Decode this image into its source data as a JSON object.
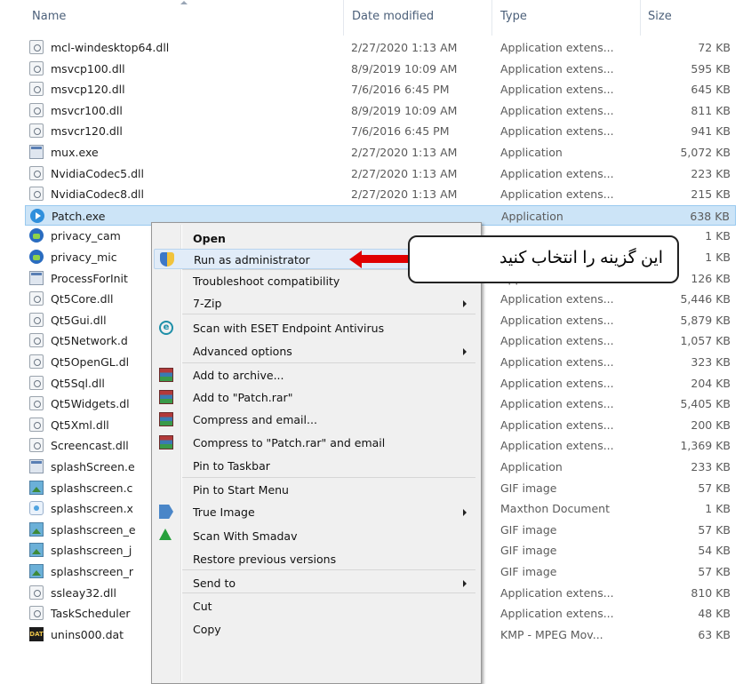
{
  "columns": {
    "name": "Name",
    "date": "Date modified",
    "type": "Type",
    "size": "Size"
  },
  "files": [
    {
      "name": "mcl-windesktop64.dll",
      "date": "2/27/2020 1:13 AM",
      "type": "Application extens...",
      "size": "72 KB",
      "icon": "dll"
    },
    {
      "name": "msvcp100.dll",
      "date": "8/9/2019 10:09 AM",
      "type": "Application extens...",
      "size": "595 KB",
      "icon": "dll"
    },
    {
      "name": "msvcp120.dll",
      "date": "7/6/2016 6:45 PM",
      "type": "Application extens...",
      "size": "645 KB",
      "icon": "dll"
    },
    {
      "name": "msvcr100.dll",
      "date": "8/9/2019 10:09 AM",
      "type": "Application extens...",
      "size": "811 KB",
      "icon": "dll"
    },
    {
      "name": "msvcr120.dll",
      "date": "7/6/2016 6:45 PM",
      "type": "Application extens...",
      "size": "941 KB",
      "icon": "dll"
    },
    {
      "name": "mux.exe",
      "date": "2/27/2020 1:13 AM",
      "type": "Application",
      "size": "5,072 KB",
      "icon": "exe"
    },
    {
      "name": "NvidiaCodec5.dll",
      "date": "2/27/2020 1:13 AM",
      "type": "Application extens...",
      "size": "223 KB",
      "icon": "dll"
    },
    {
      "name": "NvidiaCodec8.dll",
      "date": "2/27/2020 1:13 AM",
      "type": "Application extens...",
      "size": "215 KB",
      "icon": "dll"
    },
    {
      "name": "Patch.exe",
      "date": "",
      "type": "Application",
      "size": "638 KB",
      "icon": "patch",
      "selected": true
    },
    {
      "name": "privacy_cam",
      "date": "",
      "type": "",
      "size": "1 KB",
      "icon": "app2"
    },
    {
      "name": "privacy_mic",
      "date": "",
      "type": "",
      "size": "1 KB",
      "icon": "app2"
    },
    {
      "name": "ProcessForInit",
      "date": "",
      "type": "Application",
      "size": "126 KB",
      "icon": "exe"
    },
    {
      "name": "Qt5Core.dll",
      "date": "",
      "type": "Application extens...",
      "size": "5,446 KB",
      "icon": "dll"
    },
    {
      "name": "Qt5Gui.dll",
      "date": "",
      "type": "Application extens...",
      "size": "5,879 KB",
      "icon": "dll"
    },
    {
      "name": "Qt5Network.d",
      "date": "",
      "type": "Application extens...",
      "size": "1,057 KB",
      "icon": "dll"
    },
    {
      "name": "Qt5OpenGL.dl",
      "date": "",
      "type": "Application extens...",
      "size": "323 KB",
      "icon": "dll"
    },
    {
      "name": "Qt5Sql.dll",
      "date": "",
      "type": "Application extens...",
      "size": "204 KB",
      "icon": "dll"
    },
    {
      "name": "Qt5Widgets.dl",
      "date": "",
      "type": "Application extens...",
      "size": "5,405 KB",
      "icon": "dll"
    },
    {
      "name": "Qt5Xml.dll",
      "date": "",
      "type": "Application extens...",
      "size": "200 KB",
      "icon": "dll"
    },
    {
      "name": "Screencast.dll",
      "date": "",
      "type": "Application extens...",
      "size": "1,369 KB",
      "icon": "dll"
    },
    {
      "name": "splashScreen.e",
      "date": "",
      "type": "Application",
      "size": "233 KB",
      "icon": "exe"
    },
    {
      "name": "splashscreen.c",
      "date": "",
      "type": "GIF image",
      "size": "57 KB",
      "icon": "gif"
    },
    {
      "name": "splashscreen.x",
      "date": "",
      "type": "Maxthon Document",
      "size": "1 KB",
      "icon": "xml"
    },
    {
      "name": "splashscreen_e",
      "date": "",
      "type": "GIF image",
      "size": "57 KB",
      "icon": "gif"
    },
    {
      "name": "splashscreen_j",
      "date": "",
      "type": "GIF image",
      "size": "54 KB",
      "icon": "gif"
    },
    {
      "name": "splashscreen_r",
      "date": "",
      "type": "GIF image",
      "size": "57 KB",
      "icon": "gif"
    },
    {
      "name": "ssleay32.dll",
      "date": "",
      "type": "Application extens...",
      "size": "810 KB",
      "icon": "dll"
    },
    {
      "name": "TaskScheduler",
      "date": "",
      "type": "Application extens...",
      "size": "48 KB",
      "icon": "dll"
    },
    {
      "name": "unins000.dat",
      "date": "",
      "type": "KMP - MPEG Mov...",
      "size": "63 KB",
      "icon": "dat"
    }
  ],
  "context_menu": {
    "items": [
      {
        "label": "Open",
        "bold": true
      },
      {
        "label": "Run as administrator",
        "icon": "shield",
        "hover": true
      },
      {
        "label": "Troubleshoot compatibility"
      },
      {
        "label": "7-Zip",
        "submenu": true
      },
      {
        "label": "Scan with ESET Endpoint Antivirus",
        "icon": "eset"
      },
      {
        "label": "Advanced options",
        "submenu": true
      },
      {
        "label": "Add to archive...",
        "icon": "rar"
      },
      {
        "label": "Add to \"Patch.rar\"",
        "icon": "rar"
      },
      {
        "label": "Compress and email...",
        "icon": "rar"
      },
      {
        "label": "Compress to \"Patch.rar\" and email",
        "icon": "rar"
      },
      {
        "label": "Pin to Taskbar"
      },
      {
        "label": "Pin to Start Menu"
      },
      {
        "label": "True Image",
        "icon": "trueimage",
        "submenu": true
      },
      {
        "label": "Scan With Smadav",
        "icon": "smadav"
      },
      {
        "label": "Restore previous versions"
      },
      {
        "label": "Send to",
        "submenu": true
      },
      {
        "label": "Cut"
      },
      {
        "label": "Copy"
      }
    ]
  },
  "callout": {
    "text": "این گزینه را انتخاب کنید",
    "arrow_color": "#e00000"
  }
}
